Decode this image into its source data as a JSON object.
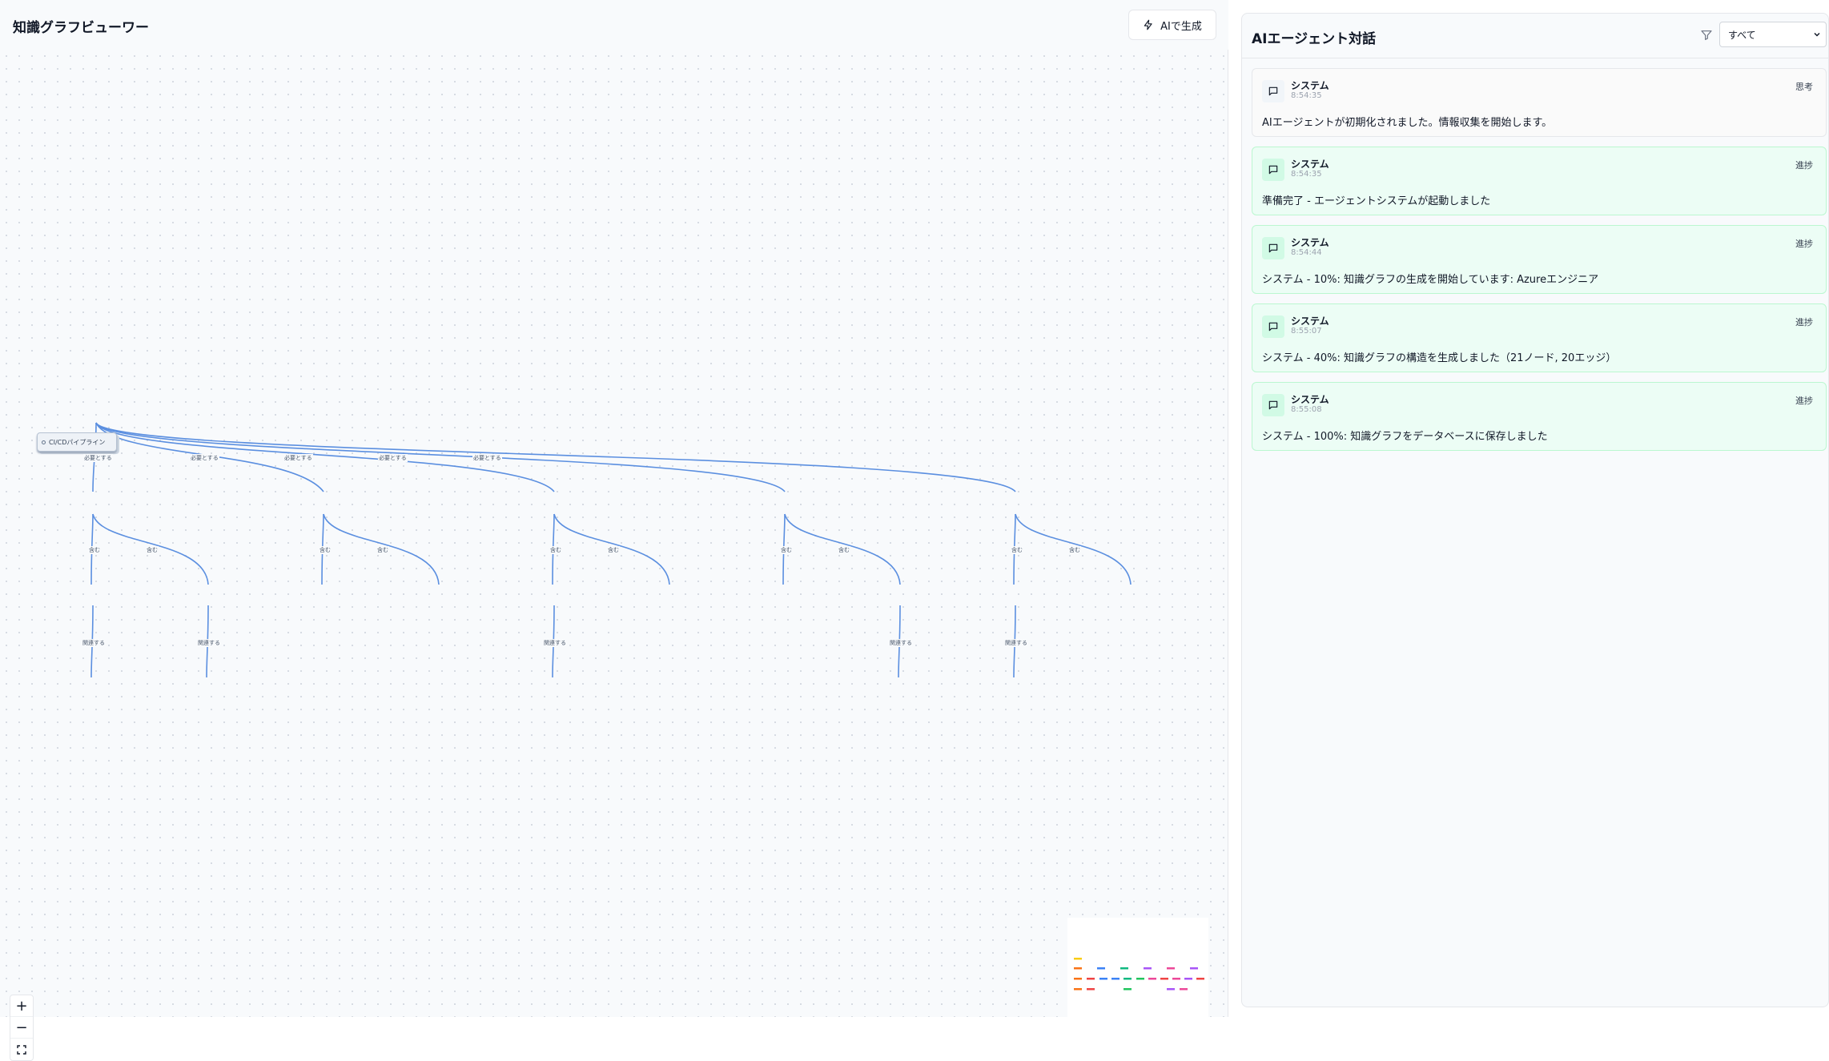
{
  "viewer": {
    "title": "知識グラフビューワー",
    "ai_button_label": "AIで生成",
    "root_node_label": "CI/CDパイプライン",
    "edge_labels": {
      "requires": "必要とする",
      "includes": "含む",
      "related": "関連する"
    },
    "zoom": {
      "in": "+",
      "out": "−",
      "fit": "⛶"
    },
    "minimap_colors": [
      "#facc15",
      "#f97316",
      "#3b82f6",
      "#10b981",
      "#22c55e",
      "#ec4899",
      "#a855f7",
      "#ef4444"
    ]
  },
  "panel": {
    "title": "AIエージェント対話",
    "filter_value": "すべて",
    "messages": [
      {
        "sender": "システム",
        "time": "8:54:35",
        "tag": "思考",
        "text": "AIエージェントが初期化されました。情報収集を開始します。",
        "kind": "thought"
      },
      {
        "sender": "システム",
        "time": "8:54:35",
        "tag": "進捗",
        "text": "準備完了 - エージェントシステムが起動しました",
        "kind": "progress"
      },
      {
        "sender": "システム",
        "time": "8:54:44",
        "tag": "進捗",
        "text": "システム - 10%: 知識グラフの生成を開始しています: Azureエンジニア",
        "kind": "progress"
      },
      {
        "sender": "システム",
        "time": "8:55:07",
        "tag": "進捗",
        "text": "システム - 40%: 知識グラフの構造を生成しました（21ノード, 20エッジ）",
        "kind": "progress"
      },
      {
        "sender": "システム",
        "time": "8:55:08",
        "tag": "進捗",
        "text": "システム - 100%: 知識グラフをデータベースに保存しました",
        "kind": "progress"
      }
    ]
  }
}
